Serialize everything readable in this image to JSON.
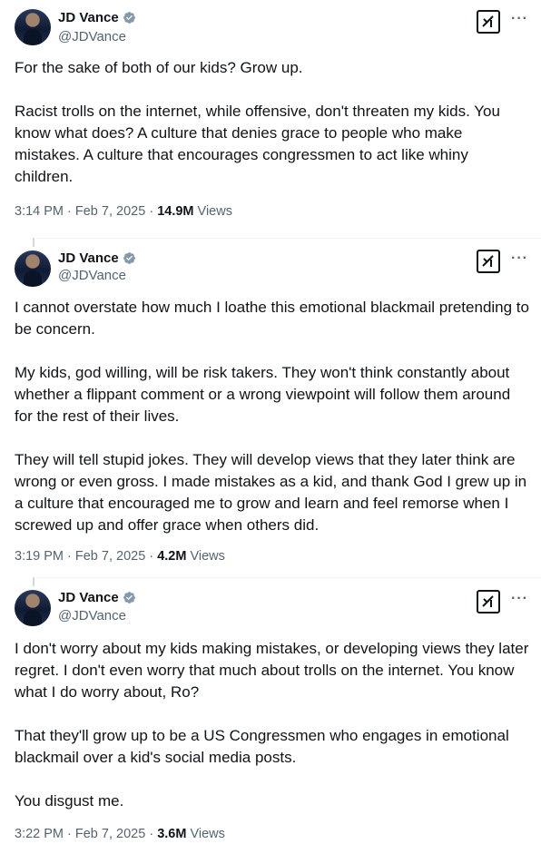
{
  "tweets": [
    {
      "author": {
        "name": "JD Vance",
        "handle": "@JDVance"
      },
      "text": "For the sake of both of our kids? Grow up.\n\nRacist trolls on the internet, while offensive, don't threaten my kids. You know what does? A culture that denies grace to people who make mistakes. A culture that encourages congressmen to act like whiny children.",
      "time": "3:14 PM",
      "date": "Feb 7, 2025",
      "views_count": "14.9M",
      "views_label": "Views"
    },
    {
      "author": {
        "name": "JD Vance",
        "handle": "@JDVance"
      },
      "text": "I cannot overstate how much I loathe this emotional blackmail pretending to be concern.\n\nMy kids, god willing, will be risk takers. They won't think constantly about whether a flippant comment or a wrong viewpoint will follow them around for the rest of their lives.\n\nThey will tell stupid jokes. They will develop views that they later think are wrong or even gross. I made mistakes as a kid, and thank God I grew up in a culture that encouraged me to grow and learn and feel remorse when I screwed up and offer grace when others did.",
      "time": "3:19 PM",
      "date": "Feb 7, 2025",
      "views_count": "4.2M",
      "views_label": "Views"
    },
    {
      "author": {
        "name": "JD Vance",
        "handle": "@JDVance"
      },
      "text": "I don't worry about my kids making mistakes, or developing views they later regret. I don't even worry that much about trolls on the internet. You know what I do worry about, Ro?\n\nThat they'll grow up to be a US Congressmen who engages in emotional blackmail over a kid's social media posts.\n\nYou disgust me.",
      "time": "3:22 PM",
      "date": "Feb 7, 2025",
      "views_count": "3.6M",
      "views_label": "Views"
    }
  ],
  "separator": " · ",
  "more_glyph": "···",
  "icons": {
    "verified": "verified-badge-icon",
    "grok": "grok-icon",
    "more": "more-icon"
  },
  "colors": {
    "verified": "#829aab",
    "secondary_text": "#536471",
    "primary_text": "#0f1419"
  }
}
